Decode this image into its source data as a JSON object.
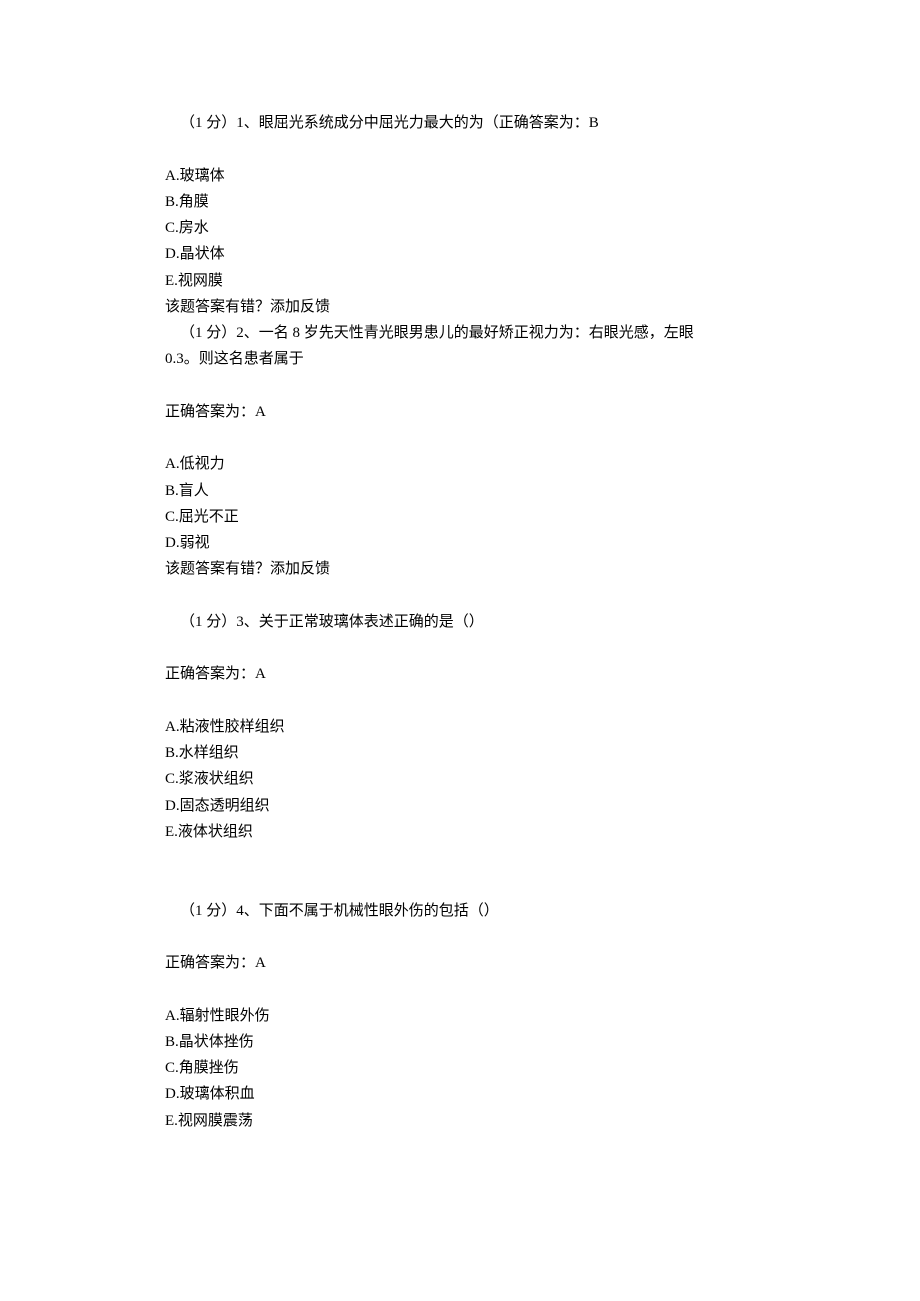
{
  "q1": {
    "header": "（1 分）1、眼屈光系统成分中屈光力最大的为（正确答案为：B",
    "optA": "A.玻璃体",
    "optB": "B.角膜",
    "optC": "C.房水",
    "optD": "D.晶状体",
    "optE": "E.视网膜",
    "feedback": "该题答案有错？添加反馈"
  },
  "q2": {
    "header": "（1 分）2、一名 8 岁先天性青光眼男患儿的最好矫正视力为：右眼光感，左眼",
    "header2": "0.3。则这名患者属于",
    "answer": "正确答案为：A",
    "optA": "A.低视力",
    "optB": "B.盲人",
    "optC": "C.屈光不正",
    "optD": "D.弱视",
    "feedback": "该题答案有错？添加反馈"
  },
  "q3": {
    "header": "（1 分）3、关于正常玻璃体表述正确的是（）",
    "answer": "正确答案为：A",
    "optA": "A.粘液性胶样组织",
    "optB": "B.水样组织",
    "optC": "C.浆液状组织",
    "optD": "D.固态透明组织",
    "optE": "E.液体状组织"
  },
  "q4": {
    "header": "（1 分）4、下面不属于机械性眼外伤的包括（）",
    "answer": "正确答案为：A",
    "optA": "A.辐射性眼外伤",
    "optB": "B.晶状体挫伤",
    "optC": "C.角膜挫伤",
    "optD": "D.玻璃体积血",
    "optE": "E.视网膜震荡"
  }
}
